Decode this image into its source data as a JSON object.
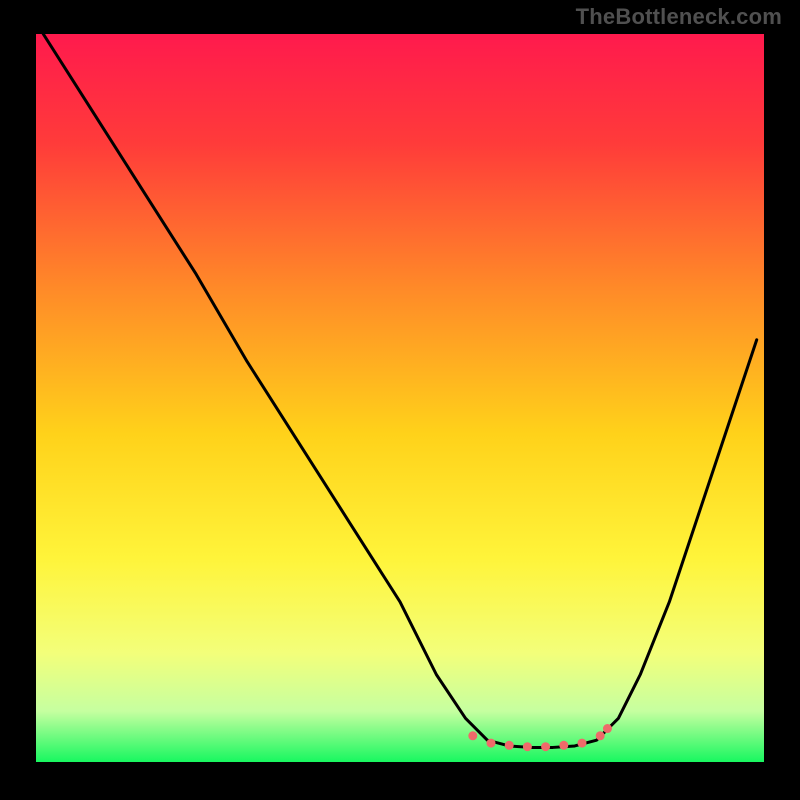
{
  "watermark": "TheBottleneck.com",
  "chart_data": {
    "type": "line",
    "title": "",
    "xlabel": "",
    "ylabel": "",
    "xlim": [
      0,
      100
    ],
    "ylim": [
      0,
      100
    ],
    "grid": false,
    "legend_position": "none",
    "gradient_stops": [
      {
        "offset": 0.0,
        "color": "#ff1a4d"
      },
      {
        "offset": 0.15,
        "color": "#ff3b3a"
      },
      {
        "offset": 0.35,
        "color": "#ff8a28"
      },
      {
        "offset": 0.55,
        "color": "#ffd21a"
      },
      {
        "offset": 0.72,
        "color": "#fff43a"
      },
      {
        "offset": 0.85,
        "color": "#f3ff7a"
      },
      {
        "offset": 0.93,
        "color": "#c6ffa0"
      },
      {
        "offset": 1.0,
        "color": "#18f760"
      }
    ],
    "series": [
      {
        "name": "curve",
        "color": "#000000",
        "x": [
          1,
          8,
          15,
          22,
          29,
          36,
          43,
          50,
          55,
          59,
          62,
          65,
          68,
          71,
          74,
          77,
          80,
          83,
          87,
          91,
          95,
          99
        ],
        "y": [
          100,
          89,
          78,
          67,
          55,
          44,
          33,
          22,
          12,
          6,
          3,
          2.2,
          2.0,
          2.0,
          2.2,
          3,
          6,
          12,
          22,
          34,
          46,
          58
        ]
      }
    ],
    "markers": {
      "color": "#ef6a6a",
      "radius": 4.5,
      "points": [
        {
          "x": 60.0,
          "y": 3.6
        },
        {
          "x": 62.5,
          "y": 2.6
        },
        {
          "x": 65.0,
          "y": 2.3
        },
        {
          "x": 67.5,
          "y": 2.1
        },
        {
          "x": 70.0,
          "y": 2.1
        },
        {
          "x": 72.5,
          "y": 2.3
        },
        {
          "x": 75.0,
          "y": 2.6
        },
        {
          "x": 77.5,
          "y": 3.6
        },
        {
          "x": 78.5,
          "y": 4.6
        }
      ]
    }
  }
}
